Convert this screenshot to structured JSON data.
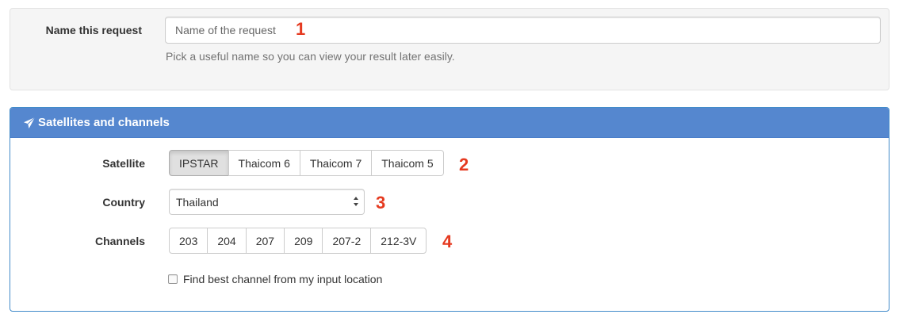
{
  "request": {
    "label": "Name this request",
    "input_value": "",
    "input_placeholder": "Name of the request",
    "help_text": "Pick a useful name so you can view your result later easily."
  },
  "panel": {
    "title": "Satellites and channels",
    "icon": "paper-plane-icon",
    "satellite": {
      "label": "Satellite",
      "options": [
        "IPSTAR",
        "Thaicom 6",
        "Thaicom 7",
        "Thaicom 5"
      ],
      "selected": "IPSTAR"
    },
    "country": {
      "label": "Country",
      "selected": "Thailand"
    },
    "channels": {
      "label": "Channels",
      "options": [
        "203",
        "204",
        "207",
        "209",
        "207-2",
        "212-3V"
      ]
    },
    "best_channel_checkbox": {
      "label": "Find best channel from my input location",
      "checked": false
    }
  },
  "annotations": [
    "1",
    "2",
    "3",
    "4"
  ],
  "colors": {
    "panel_heading": "#5587cf",
    "marker": "#e53a20",
    "well_bg": "#f5f5f5"
  }
}
